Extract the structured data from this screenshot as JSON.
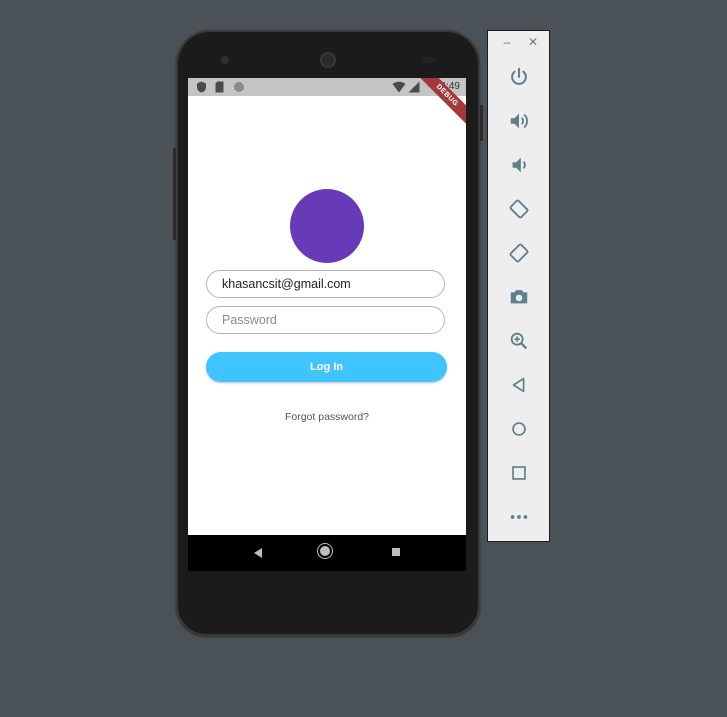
{
  "app": {
    "status_bar": {
      "time": "4:49"
    },
    "debug_banner": "DEBUG",
    "login": {
      "email_value": "khasancsit@gmail.com",
      "password_placeholder": "Password",
      "login_label": "Log In",
      "forgot_label": "Forgot password?"
    },
    "colors": {
      "avatar": "#673ab7",
      "login_button": "#40c4ff"
    }
  },
  "emulator_toolbar": {
    "window_controls": [
      "minimize-icon",
      "close-icon"
    ],
    "buttons": [
      "power-icon",
      "volume-up-icon",
      "volume-down-icon",
      "rotate-left-icon",
      "rotate-right-icon",
      "camera-icon",
      "zoom-icon",
      "back-icon",
      "home-icon",
      "overview-icon",
      "more-icon"
    ]
  }
}
